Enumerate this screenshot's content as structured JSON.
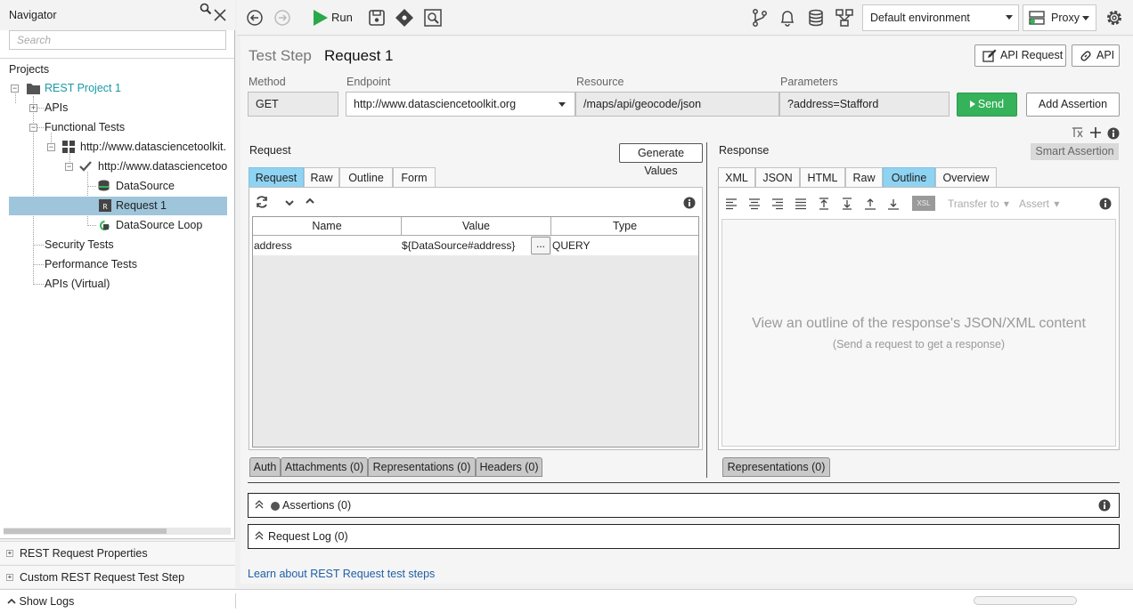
{
  "navigator": {
    "title": "Navigator",
    "search_placeholder": "Search",
    "projects_label": "Projects",
    "tree": [
      {
        "label": "REST Project 1"
      },
      {
        "label": "APIs"
      },
      {
        "label": "Functional Tests"
      },
      {
        "label": "http://www.datasciencetoolkit."
      },
      {
        "label": "http://www.datasciencetoo"
      },
      {
        "label": "DataSource"
      },
      {
        "label": "Request 1"
      },
      {
        "label": "DataSource Loop"
      },
      {
        "label": "Security Tests"
      },
      {
        "label": "Performance Tests"
      },
      {
        "label": "APIs (Virtual)"
      }
    ],
    "properties": [
      "REST Request Properties",
      "Custom REST Request Test Step Properties"
    ],
    "show_logs": "Show Logs"
  },
  "toolbar": {
    "run_label": "Run",
    "environment": "Default environment",
    "proxy_label": "Proxy"
  },
  "step": {
    "kind": "Test Step",
    "name": "Request 1",
    "api_request_btn": "API Request",
    "api_btn": "API"
  },
  "fields": {
    "method_label": "Method",
    "method": "GET",
    "endpoint_label": "Endpoint",
    "endpoint": "http://www.datasciencetoolkit.org",
    "resource_label": "Resource",
    "resource": "/maps/api/geocode/json",
    "parameters_label": "Parameters",
    "parameters": "?address=Stafford",
    "send": "Send",
    "add_assertion": "Add Assertion"
  },
  "request": {
    "title": "Request",
    "generate_values": "Generate Values",
    "tabs": [
      "Request",
      "Raw",
      "Outline",
      "Form"
    ],
    "active_tab": "Request",
    "grid_headers": [
      "Name",
      "Value",
      "Type"
    ],
    "rows": [
      {
        "name": "address",
        "value": "${DataSource#address}",
        "ellipsis": "...",
        "type": "QUERY"
      }
    ],
    "bottom_tabs": [
      "Auth",
      "Attachments (0)",
      "Representations (0)",
      "Headers (0)"
    ]
  },
  "response": {
    "title": "Response",
    "smart_assertion": "Smart Assertion",
    "tabs": [
      "XML",
      "JSON",
      "HTML",
      "Raw",
      "Outline",
      "Overview"
    ],
    "active_tab": "Outline",
    "transfer_to": "Transfer to",
    "assert": "Assert",
    "xsl_label": "XSL",
    "empty_title": "View an outline of the response's JSON/XML content",
    "empty_hint": "(Send a request to get a response)",
    "bottom_tabs": [
      "Representations (0)"
    ]
  },
  "assertions_bar": "Assertions (0)",
  "request_log_bar": "Request Log (0)",
  "learn_link": "Learn about REST Request test steps",
  "colors": {
    "accent_tab": "#8fd3f2",
    "send_green": "#35b25a",
    "selected_row": "#9fc5db",
    "project_teal": "#1a9ba6",
    "link_blue": "#1f5fa8"
  }
}
